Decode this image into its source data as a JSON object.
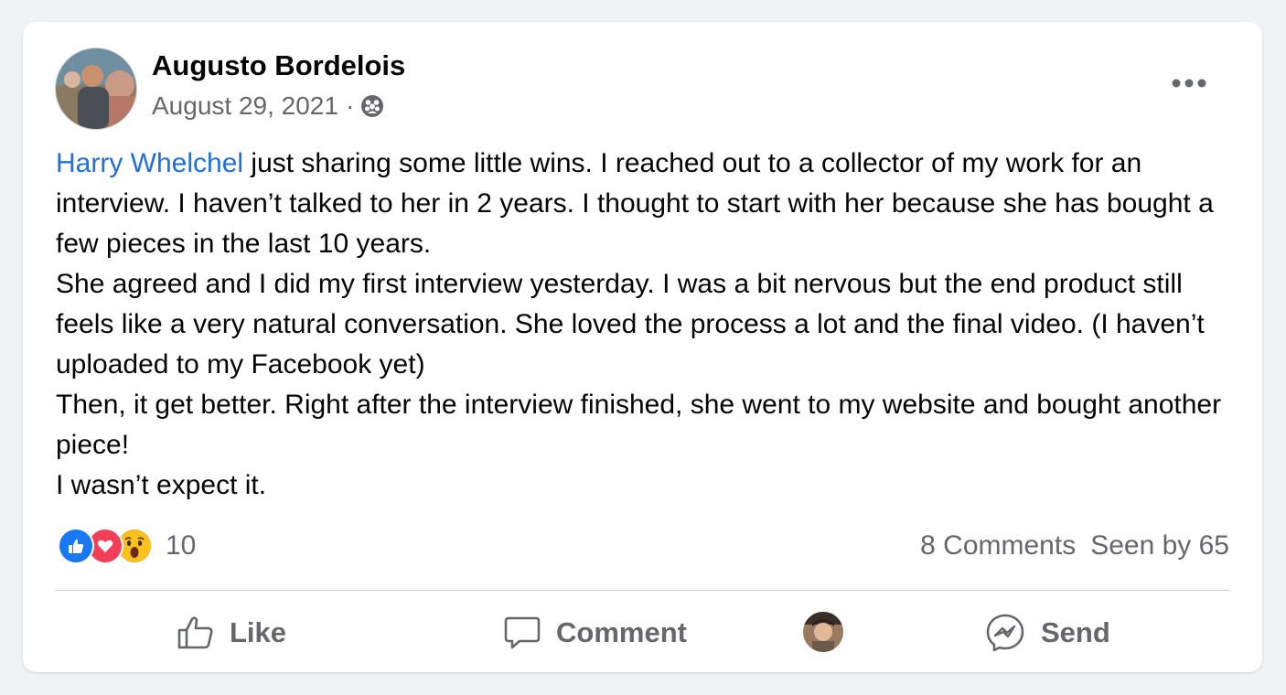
{
  "post": {
    "author": "Augusto Bordelois",
    "date": "August 29, 2021",
    "separator": "·",
    "audience_icon": "group-icon",
    "mention": "Harry Whelchel",
    "paragraphs": [
      " just sharing some little wins. I reached out to a collector of my work for an interview. I haven’t talked to her in 2 years. I thought to start with her because she has bought a few pieces in the last 10 years.",
      "She agreed and I did my first interview yesterday. I was a bit nervous but the end product still feels like a very natural conversation. She loved the process a lot and the final video. (I haven’t uploaded to my Facebook yet)",
      "Then, it get better. Right after the interview finished, she went to my website and bought another piece!",
      "I wasn’t expect it."
    ]
  },
  "reactions": {
    "types": [
      "like-icon",
      "love-icon",
      "wow-icon"
    ],
    "count": "10"
  },
  "stats": {
    "comments": "8 Comments",
    "seen": "Seen by 65"
  },
  "actions": {
    "like": "Like",
    "comment": "Comment",
    "send": "Send"
  },
  "colors": {
    "mention": "#216fdb",
    "secondary_text": "#65676b",
    "like": "#1877f2",
    "love": "#f33e58",
    "wow": "#f7b125"
  }
}
